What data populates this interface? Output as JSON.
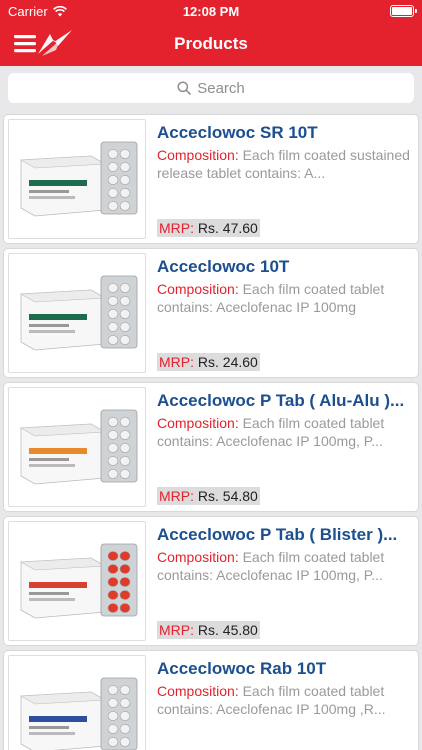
{
  "status": {
    "carrier": "Carrier",
    "time": "12:08 PM"
  },
  "nav": {
    "title": "Products"
  },
  "search": {
    "placeholder": "Search"
  },
  "composition_label": "Composition:",
  "mrp_label": "MRP:",
  "products": [
    {
      "name": "Acceclowoc  SR 10T",
      "composition": "Each film coated sustained release tablet contains: A...",
      "mrp": "Rs. 47.60",
      "pack_color": "#1f6b4e",
      "tablet_color": "#f2f2f2"
    },
    {
      "name": "Acceclowoc 10T",
      "composition": "Each film coated tablet contains: Aceclofenac IP 100mg",
      "mrp": "Rs. 24.60",
      "pack_color": "#1f6b4e",
      "tablet_color": "#f2f2f2"
    },
    {
      "name": "Acceclowoc P Tab ( Alu-Alu )...",
      "composition": "Each film coated tablet contains: Aceclofenac IP 100mg, P...",
      "mrp": "Rs. 54.80",
      "pack_color": "#e8892b",
      "tablet_color": "#f2f2f2"
    },
    {
      "name": "Acceclowoc P Tab ( Blister )...",
      "composition": "Each film coated tablet contains: Aceclofenac IP 100mg, P...",
      "mrp": "Rs. 45.80",
      "pack_color": "#d7402f",
      "tablet_color": "#e23a2a"
    },
    {
      "name": "Acceclowoc Rab 10T",
      "composition": "Each film coated tablet contains: Aceclofenac IP 100mg ,R...",
      "mrp": "",
      "pack_color": "#2d4f9e",
      "tablet_color": "#f2f2f2"
    }
  ]
}
